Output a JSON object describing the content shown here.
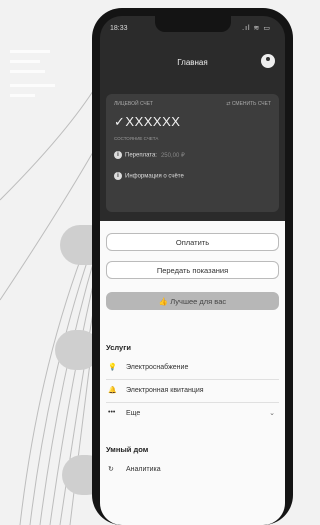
{
  "status": {
    "time": "18:33",
    "signal": ".ıl ≋ ▭"
  },
  "header": {
    "title": "Главная"
  },
  "card": {
    "label": "ЛИЦЕВОЙ СЧЕТ",
    "change_label": "⇄ СМЕНИТЬ СЧЕТ",
    "account": "✓XXXXXX",
    "state": "СОСТОЯНИЕ СЧЕТА",
    "overpay_label": "Переплата:",
    "overpay_value": "250,00 ₽",
    "info_label": "Информация о счёте"
  },
  "buttons": {
    "pay": "Оплатить",
    "readings": "Передать показания",
    "best": "Лучшее для вас"
  },
  "services": {
    "title": "Услуги",
    "items": [
      {
        "label": "Электроснабжение",
        "icon": "bulb-icon"
      },
      {
        "label": "Электронная квитанция",
        "icon": "bell-icon"
      },
      {
        "label": "Еще",
        "icon": "more-icon"
      }
    ]
  },
  "smart_home": {
    "title": "Умный дом",
    "items": [
      {
        "label": "Аналитика",
        "icon": "refresh-icon"
      }
    ]
  }
}
